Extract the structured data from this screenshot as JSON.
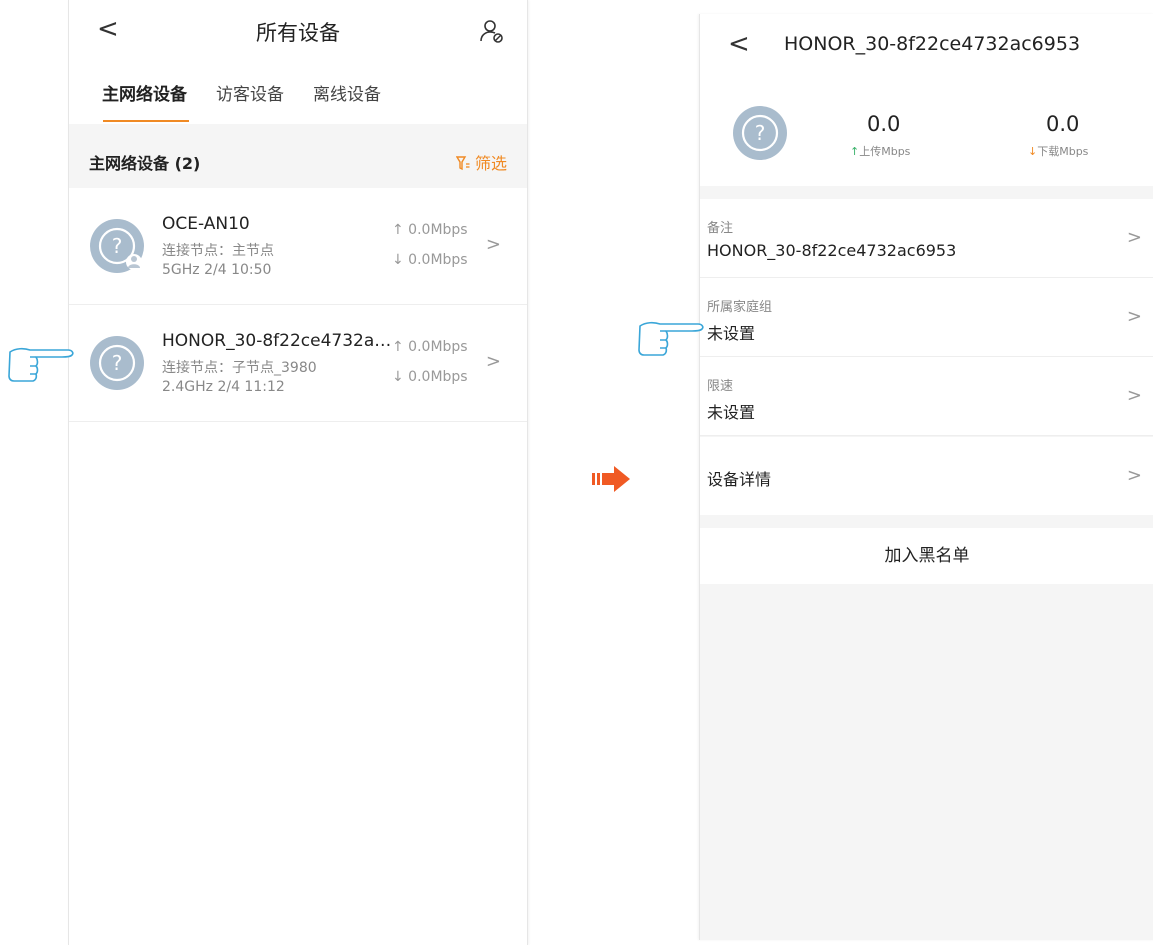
{
  "left": {
    "header": {
      "back": "<",
      "title": "所有设备",
      "user_icon": "user-settings-icon"
    },
    "tabs": [
      {
        "label": "主网络设备"
      },
      {
        "label": "访客设备"
      },
      {
        "label": "离线设备"
      }
    ],
    "section": {
      "title": "主网络设备 (2)",
      "filter": "筛选",
      "filter_icon": "filter-icon"
    },
    "devices": [
      {
        "name": "OCE-AN10",
        "node": "连接节点：主节点",
        "band": "5GHz  2/4 10:50",
        "up": "↑ 0.0Mbps",
        "down": "↓ 0.0Mbps",
        "chevron": ">"
      },
      {
        "name": "HONOR_30-8f22ce4732a…",
        "node": "连接节点：子节点_3980",
        "band": "2.4GHz  2/4 11:12",
        "up": "↑ 0.0Mbps",
        "down": "↓ 0.0Mbps",
        "chevron": ">"
      }
    ]
  },
  "right": {
    "header": {
      "back": "<",
      "title": "HONOR_30-8f22ce4732ac6953"
    },
    "speed": {
      "upload_value": "0.0",
      "upload_label": "上传Mbps",
      "upload_arrow": "↑",
      "download_value": "0.0",
      "download_label": "下载Mbps",
      "download_arrow": "↓"
    },
    "rows": [
      {
        "label": "备注",
        "value": "HONOR_30-8f22ce4732ac6953",
        "chevron": ">"
      },
      {
        "label": "所属家庭组",
        "value": "未设置",
        "chevron": ">"
      },
      {
        "label": "限速",
        "value": "未设置",
        "chevron": ">"
      }
    ],
    "details": {
      "label": "设备详情",
      "chevron": ">"
    },
    "blacklist": "加入黑名单"
  },
  "colors": {
    "accent": "#f08a24",
    "upload": "#3bb26b",
    "avatar": "#a9bccd"
  }
}
